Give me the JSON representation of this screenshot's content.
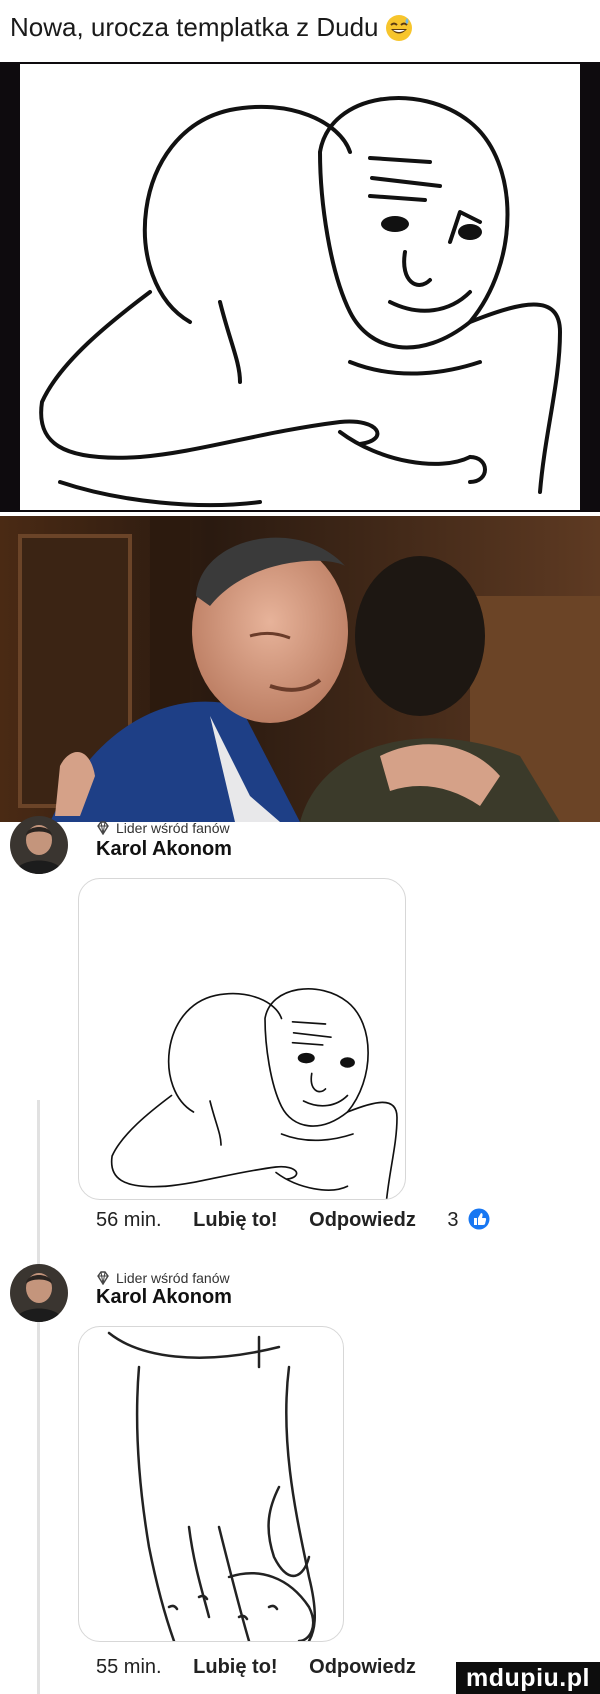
{
  "post": {
    "title": "Nowa, urocza templatka z Dudu",
    "title_emoji": "grinning-sweat-emoji"
  },
  "comments": [
    {
      "badge": "Lider wśród fanów",
      "author": "Karol Akonom",
      "time": "56 min.",
      "like_label": "Lubię to!",
      "reply_label": "Odpowiedz",
      "like_count": "3",
      "reaction_icon": "like-thumb-icon"
    },
    {
      "badge": "Lider wśród fanów",
      "author": "Karol Akonom",
      "time": "55 min.",
      "like_label": "Lubię to!",
      "reply_label": "Odpowiedz"
    }
  ],
  "watermark": "mdupiu.pl",
  "colors": {
    "meme_background": "#0e0b0e",
    "like_blue": "#1877f2",
    "card_border": "#d7d7d7"
  }
}
